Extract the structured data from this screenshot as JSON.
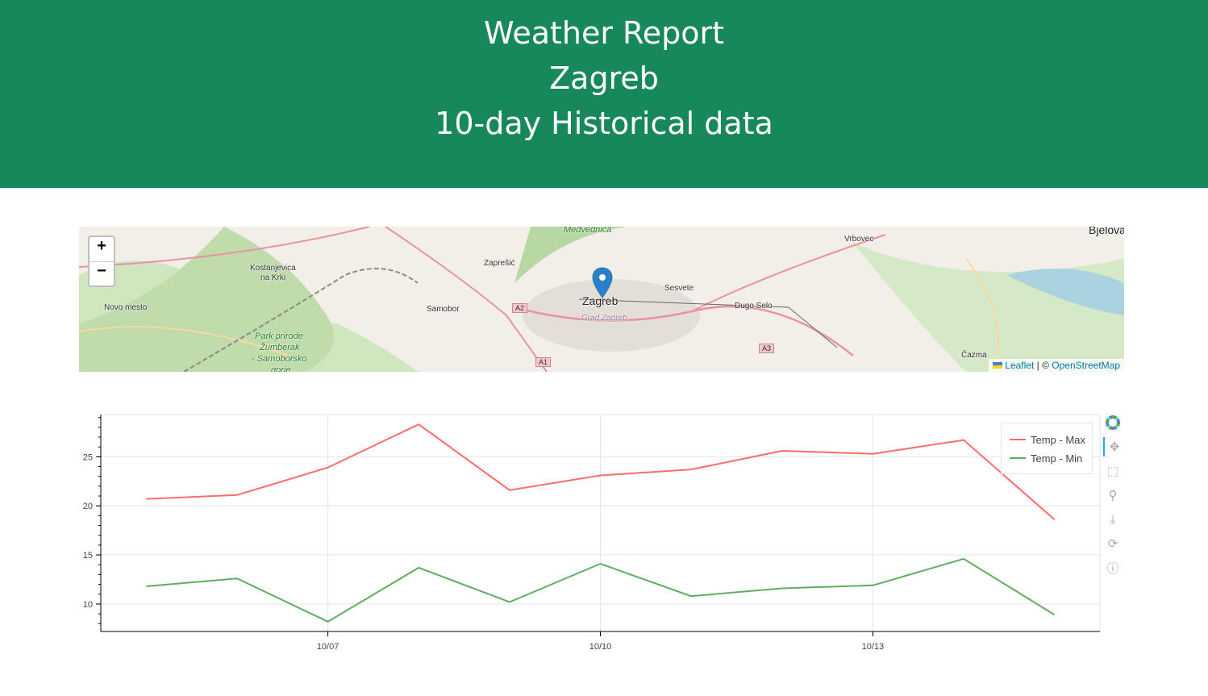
{
  "header": {
    "line1": "Weather Report",
    "line2": "Zagreb",
    "line3": "10-day Historical data",
    "background": "#17885a"
  },
  "map": {
    "zoom_in": "+",
    "zoom_out": "−",
    "marker_icon": "map-pin-icon",
    "places": [
      "Zagreb",
      "Grad Zagreb",
      "Zaprešić",
      "Sesvete",
      "Dugo Selo",
      "Samobor",
      "Kostanjevica",
      "na Krki",
      "Novo mesto",
      "Vrbovec",
      "Bjelova",
      "Čazma",
      "Medvednica",
      "Park prirode",
      "Žumberak",
      "- Samoborsko",
      "gorje"
    ],
    "roads": [
      "A2",
      "A1",
      "A3"
    ],
    "attribution": {
      "leaflet": "Leaflet",
      "separator": " | © ",
      "osm": "OpenStreetMap"
    }
  },
  "legend": {
    "max": "Temp - Max",
    "min": "Temp - Min"
  },
  "toolbar": [
    "bokeh-logo-icon",
    "pan-icon",
    "box-zoom-icon",
    "wheel-zoom-icon",
    "save-icon",
    "reset-icon",
    "help-icon"
  ],
  "chart_data": {
    "type": "line",
    "x": [
      "10/05",
      "10/06",
      "10/07",
      "10/08",
      "10/09",
      "10/10",
      "10/11",
      "10/12",
      "10/13",
      "10/14",
      "10/15"
    ],
    "xticks": [
      "10/07",
      "10/10",
      "10/13"
    ],
    "yticks": [
      "10",
      "15",
      "20",
      "25"
    ],
    "ylim": [
      7.2,
      29.3
    ],
    "xlim": [
      "10/04 12:00",
      "10/15 12:00"
    ],
    "grid": true,
    "legend_position": "top-right",
    "series": [
      {
        "name": "Temp - Max",
        "color": "#ff6b6b",
        "values": [
          20.7,
          21.1,
          23.9,
          28.3,
          21.6,
          23.1,
          23.7,
          25.6,
          25.3,
          26.7,
          18.6
        ]
      },
      {
        "name": "Temp - Min",
        "color": "#5fae5f",
        "values": [
          11.8,
          12.6,
          8.2,
          13.7,
          10.2,
          14.1,
          10.8,
          11.6,
          11.9,
          14.6,
          8.9
        ]
      }
    ]
  }
}
